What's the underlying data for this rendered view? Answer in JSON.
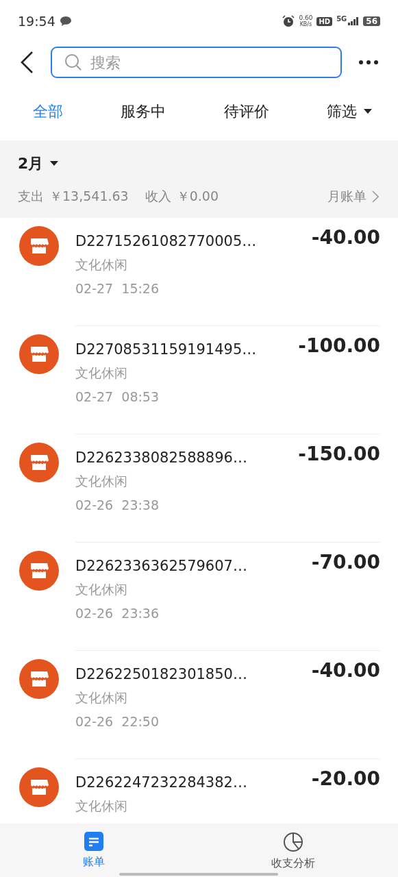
{
  "status_bar": {
    "time": "19:54",
    "speed": "0.60",
    "speed_unit": "KB/s",
    "hd": "HD",
    "network": "5G",
    "battery": "56"
  },
  "header": {
    "search": {
      "placeholder": "搜索"
    }
  },
  "tabs": [
    {
      "label": "全部",
      "selected": true
    },
    {
      "label": "服务中",
      "selected": false
    },
    {
      "label": "待评价",
      "selected": false
    },
    {
      "label": "筛选",
      "selected": false,
      "kind": "dropdown"
    }
  ],
  "month": {
    "label": "2月",
    "expense_label": "支出",
    "expense": "￥13,541.63",
    "income_label": "收入",
    "income": "￥0.00",
    "monthly_bill": "月账单"
  },
  "transactions": [
    {
      "title": "D22715261082770005…",
      "category": "文化休闲",
      "date": "02-27",
      "time": "15:26",
      "amount": "-40.00"
    },
    {
      "title": "D22708531159191495…",
      "category": "文化休闲",
      "date": "02-27",
      "time": "08:53",
      "amount": "-100.00"
    },
    {
      "title": "D2262338082588896…",
      "category": "文化休闲",
      "date": "02-26",
      "time": "23:38",
      "amount": "-150.00"
    },
    {
      "title": "D2262336362579607…",
      "category": "文化休闲",
      "date": "02-26",
      "time": "23:36",
      "amount": "-70.00"
    },
    {
      "title": "D2262250182301850…",
      "category": "文化休闲",
      "date": "02-26",
      "time": "22:50",
      "amount": "-40.00"
    },
    {
      "title": "D2262247232284382…",
      "category": "文化休闲",
      "amount": "-20.00"
    }
  ],
  "bottom_nav": [
    {
      "label": "账单",
      "selected": true,
      "kind": "bill"
    },
    {
      "label": "收支分析",
      "selected": false,
      "kind": "pie"
    }
  ]
}
